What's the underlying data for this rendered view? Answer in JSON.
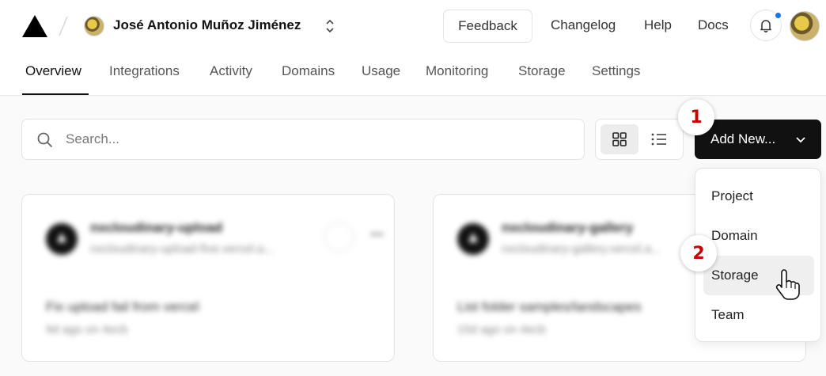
{
  "header": {
    "team_name": "José Antonio Muñoz Jiménez",
    "feedback_label": "Feedback",
    "links": [
      "Changelog",
      "Help",
      "Docs"
    ]
  },
  "tabs": [
    "Overview",
    "Integrations",
    "Activity",
    "Domains",
    "Usage",
    "Monitoring",
    "Storage",
    "Settings"
  ],
  "active_tab": "Overview",
  "search": {
    "placeholder": "Search..."
  },
  "view_toggle": {
    "active": "grid"
  },
  "add_new": {
    "label": "Add New..."
  },
  "menu": {
    "items": [
      "Project",
      "Domain",
      "Storage",
      "Team"
    ],
    "hovered": "Storage"
  },
  "projects": [
    {
      "name": "nxcloudinary-upload",
      "url": "nxcloudinary-upload-five.vercel.a...",
      "commit": "Fix upload fail from vercel",
      "meta": "9d ago on  4ecb"
    },
    {
      "name": "nxcloudinary-gallery",
      "url": "nxcloudinary-gallery.vercel.a...",
      "commit": "List folder samples/landscapes",
      "meta": "15d ago on  4ecb"
    }
  ],
  "steps": [
    "1",
    "2"
  ],
  "colors": {
    "accent": "#111111",
    "notification": "#1a73e8",
    "step_number": "#cc0000"
  }
}
